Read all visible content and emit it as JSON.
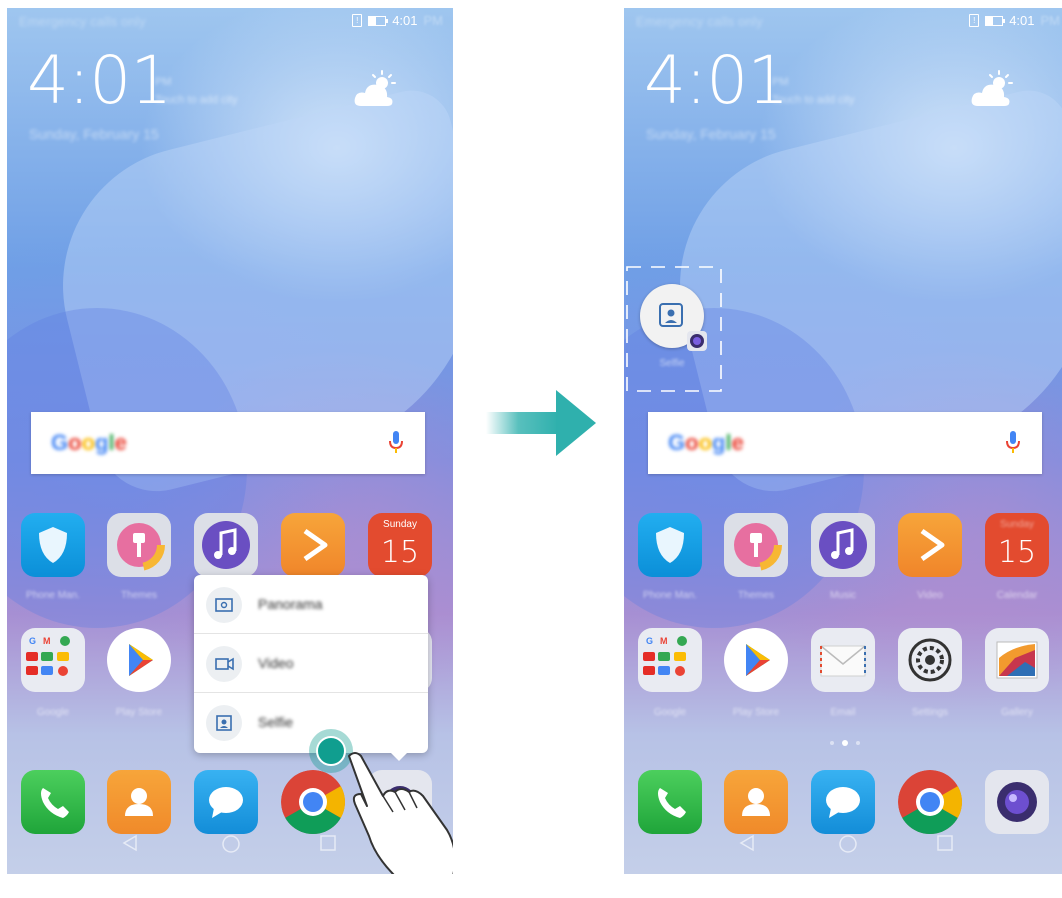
{
  "status_bar": {
    "left_text": "Emergency calls only",
    "time": "4:01",
    "ampm": "PM"
  },
  "clock": {
    "time": "4:01",
    "ampm": "PM",
    "city": "Touch to add city",
    "date": "Sunday, February 15"
  },
  "search": {
    "logo_letters": [
      "G",
      "o",
      "o",
      "g",
      "l",
      "e"
    ]
  },
  "apps_row1": [
    {
      "label": "Phone Man.",
      "icon": "shield-icon"
    },
    {
      "label": "Themes",
      "icon": "brush-icon"
    },
    {
      "label": "Music",
      "icon": "music-icon"
    },
    {
      "label": "Video",
      "icon": "play-icon"
    },
    {
      "label": "Calendar",
      "icon": "calendar-icon",
      "day": "Sunday",
      "date": "15"
    }
  ],
  "apps_row2": [
    {
      "label": "Google",
      "icon": "google-folder-icon"
    },
    {
      "label": "Play Store",
      "icon": "play-store-icon"
    },
    {
      "label": "Email",
      "icon": "mail-icon"
    },
    {
      "label": "Settings",
      "icon": "settings-icon"
    },
    {
      "label": "Gallery",
      "icon": "gallery-icon"
    }
  ],
  "dock": [
    {
      "icon": "phone-icon"
    },
    {
      "icon": "contacts-icon"
    },
    {
      "icon": "messages-icon"
    },
    {
      "icon": "chrome-icon"
    },
    {
      "icon": "camera-icon"
    }
  ],
  "popup_menu": [
    {
      "label": "Panorama",
      "icon": "panorama-icon"
    },
    {
      "label": "Video",
      "icon": "video-icon"
    },
    {
      "label": "Selfie",
      "icon": "selfie-icon"
    }
  ],
  "shortcut": {
    "label": "Selfie",
    "icon": "selfie-shortcut-icon"
  },
  "colors": {
    "accent_teal": "#109e8f",
    "arrow": "#2fb0ad"
  }
}
